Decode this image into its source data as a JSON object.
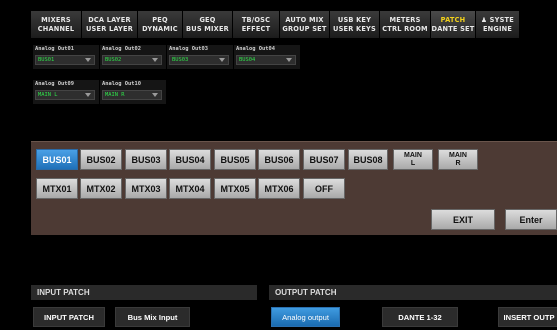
{
  "tabs": [
    {
      "line1": "MIXERS",
      "line2": "CHANNEL"
    },
    {
      "line1": "DCA LAYER",
      "line2": "USER LAYER"
    },
    {
      "line1": "PEQ",
      "line2": "DYNAMIC"
    },
    {
      "line1": "GEQ",
      "line2": "BUS MIXER"
    },
    {
      "line1": "TB/OSC",
      "line2": "EFFECT"
    },
    {
      "line1": "AUTO MIX",
      "line2": "GROUP SET"
    },
    {
      "line1": "USB KEY",
      "line2": "USER KEYS"
    },
    {
      "line1": "METERS",
      "line2": "CTRL ROOM"
    },
    {
      "line1": "PATCH",
      "line2": "DANTE SET",
      "active": true
    },
    {
      "line1": "♟ SYSTE",
      "line2": "ENGINE"
    }
  ],
  "analog_outputs": [
    {
      "label": "Analog Out01",
      "value": "BUS01"
    },
    {
      "label": "Analog Out02",
      "value": "BUS02"
    },
    {
      "label": "Analog Out03",
      "value": "BUS03"
    },
    {
      "label": "Analog Out04",
      "value": "BUS04"
    },
    {
      "label": "Analog Out09",
      "value": "MAIN L"
    },
    {
      "label": "Analog Out10",
      "value": "MAIN R"
    }
  ],
  "selector": {
    "row1": [
      {
        "label": "BUS01",
        "selected": true
      },
      {
        "label": "BUS02"
      },
      {
        "label": "BUS03"
      },
      {
        "label": "BUS04"
      },
      {
        "label": "BUS05"
      },
      {
        "label": "BUS06"
      },
      {
        "label": "BUS07"
      },
      {
        "label": "BUS08"
      },
      {
        "label": "MAIN",
        "sub": "L"
      },
      {
        "label": "MAIN",
        "sub": "R"
      }
    ],
    "row2": [
      {
        "label": "MTX01"
      },
      {
        "label": "MTX02"
      },
      {
        "label": "MTX03"
      },
      {
        "label": "MTX04"
      },
      {
        "label": "MTX05"
      },
      {
        "label": "MTX06"
      },
      {
        "label": "OFF"
      }
    ],
    "exit_label": "EXIT",
    "enter_label": "Enter"
  },
  "input_patch": {
    "header": "INPUT PATCH",
    "buttons": [
      "INPUT PATCH",
      "Bus Mix Input"
    ]
  },
  "output_patch": {
    "header": "OUTPUT PATCH",
    "buttons": [
      "Analog output",
      "DANTE 1-32",
      "INSERT OUTP"
    ],
    "active_index": 0
  },
  "colors": {
    "accent_blue": "#2a82d0",
    "popup_bg": "#4d3a34",
    "value_green": "#2fe04a",
    "active_tab_text": "#f3d21a"
  }
}
